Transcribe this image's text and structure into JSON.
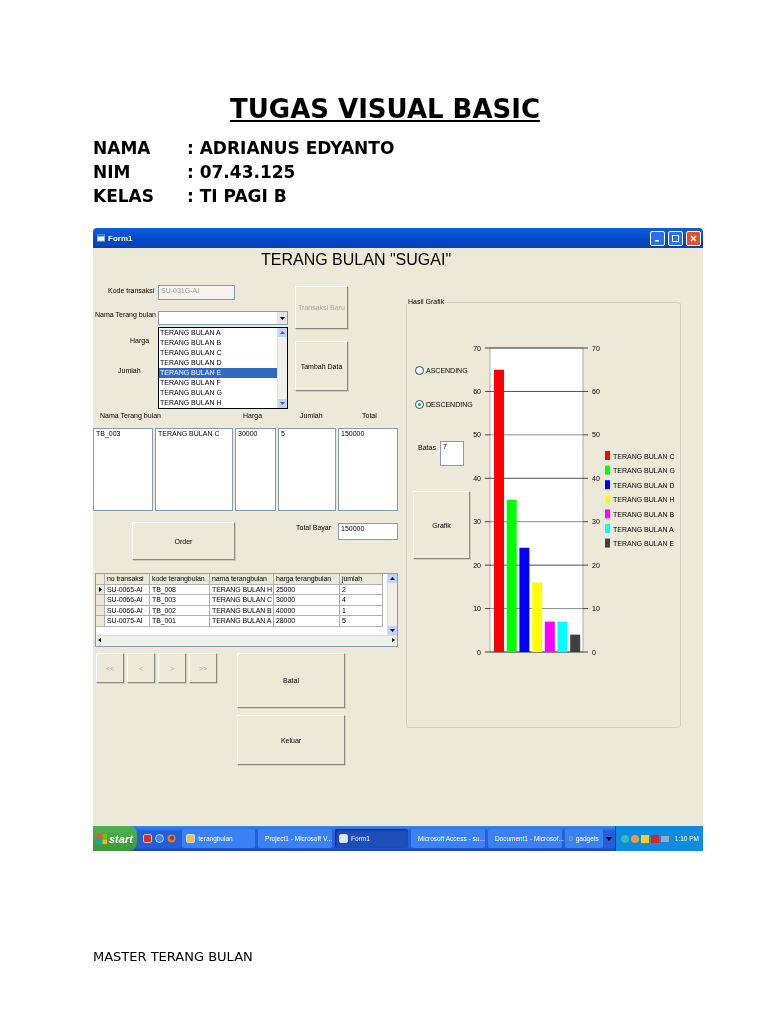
{
  "document": {
    "title": "TUGAS VISUAL BASIC",
    "fields": [
      {
        "label": "NAMA",
        "value": ": ADRIANUS EDYANTO"
      },
      {
        "label": "NIM",
        "value": ": 07.43.125"
      },
      {
        "label": "KELAS",
        "value": ": TI PAGI B"
      }
    ],
    "footer": "MASTER TERANG BULAN"
  },
  "window": {
    "title": "Form1"
  },
  "form": {
    "heading": "TERANG BULAN \"SUGAI\"",
    "kode_transaksi": {
      "label": "Kode transaksi",
      "value": "SU-031G-AI",
      "disabled": true
    },
    "nama_terang_bulan": {
      "label": "Nama Terang bulan",
      "options": [
        {
          "label": "TERANG BULAN A",
          "selected": false
        },
        {
          "label": "TERANG BULAN B",
          "selected": false
        },
        {
          "label": "TERANG BULAN C",
          "selected": false
        },
        {
          "label": "TERANG BULAN D",
          "selected": false
        },
        {
          "label": "TERANG BULAN E",
          "selected": true
        },
        {
          "label": "TERANG BULAN F",
          "selected": false
        },
        {
          "label": "TERANG BULAN G",
          "selected": false
        },
        {
          "label": "TERANG BULAN H",
          "selected": false
        }
      ]
    },
    "harga_label": "Harga",
    "jumlah_label": "Jumlah",
    "transaksi_baru": {
      "label": "Transaksi Baru",
      "disabled": true
    },
    "tambah_data": {
      "label": "Tambah Data",
      "disabled": false
    },
    "list_headers": [
      "Nama Terang bulan",
      "Harga",
      "Jumlah",
      "Total"
    ],
    "lists": [
      [
        "TB_003"
      ],
      [
        "TERANG BULAN C"
      ],
      [
        "30000"
      ],
      [
        "5"
      ],
      [
        "150000"
      ]
    ],
    "order_button": "Order",
    "total_bayar": {
      "label": "Total Bayar",
      "value": "150000"
    },
    "grid": {
      "columns": [
        "no transaksi",
        "kode terangbulan",
        "nama terangbulan",
        "harga terangbulan",
        "jumlah"
      ],
      "rows": [
        {
          "selected": true,
          "cells": [
            "SU-0065-AI",
            "TB_008",
            "TERANG BULAN H",
            "25000",
            "2"
          ]
        },
        {
          "selected": false,
          "cells": [
            "SU-0066-AI",
            "TB_003",
            "TERANG BULAN C",
            "30000",
            "4"
          ]
        },
        {
          "selected": false,
          "cells": [
            "SU-0066-AI",
            "TB_002",
            "TERANG BULAN B",
            "40000",
            "1"
          ]
        },
        {
          "selected": false,
          "cells": [
            "SU-0075-AI",
            "TB_001",
            "TERANG BULAN A",
            "28000",
            "5"
          ]
        }
      ]
    },
    "nav_buttons": [
      {
        "label": "<<",
        "disabled": true
      },
      {
        "label": "<",
        "disabled": true
      },
      {
        "label": ">",
        "disabled": true
      },
      {
        "label": ">>",
        "disabled": true
      }
    ],
    "batal_button": "Batal",
    "keluar_button": "Keluar",
    "group": {
      "title": "Hasil Grafik",
      "sort": [
        {
          "label": "ASCENDING",
          "selected": false
        },
        {
          "label": "DESCENDING",
          "selected": true
        }
      ],
      "batas": {
        "label": "Batas",
        "value": "7"
      },
      "grafik_button": "Grafik",
      "chart_data": {
        "type": "bar",
        "ylim": [
          0,
          70
        ],
        "yticks": [
          0,
          10,
          20,
          30,
          40,
          50,
          60,
          70
        ],
        "y2lim": [
          0,
          70
        ],
        "y2ticks": [
          0,
          10,
          20,
          30,
          40,
          50,
          60,
          70
        ],
        "grid": true,
        "legend": true,
        "series": [
          {
            "name": "TERANG BULAN C",
            "color": "#ff0000",
            "values": [
              65
            ]
          },
          {
            "name": "TERANG BULAN G",
            "color": "#00ff00",
            "values": [
              35
            ]
          },
          {
            "name": "TERANG BULAN D",
            "color": "#0000ff",
            "values": [
              24
            ]
          },
          {
            "name": "TERANG BULAN H",
            "color": "#ffff00",
            "values": [
              16
            ]
          },
          {
            "name": "TERANG BULAN B",
            "color": "#ff00ff",
            "values": [
              7
            ]
          },
          {
            "name": "TERANG BULAN A",
            "color": "#00ffff",
            "values": [
              7
            ]
          },
          {
            "name": "TERANG BULAN E",
            "color": "#404040",
            "values": [
              4
            ]
          }
        ]
      }
    }
  },
  "taskbar": {
    "start": "start",
    "items": [
      {
        "label": "terangbulan",
        "selected": false
      },
      {
        "label": "Project1 - Microsoft V...",
        "selected": false
      },
      {
        "label": "Form1",
        "selected": true
      },
      {
        "label": "Microsoft Access - su...",
        "selected": false
      },
      {
        "label": "Document1 - Microsof...",
        "selected": false
      },
      {
        "label": "gadgets",
        "selected": false
      }
    ],
    "clock": "1:10 PM"
  }
}
